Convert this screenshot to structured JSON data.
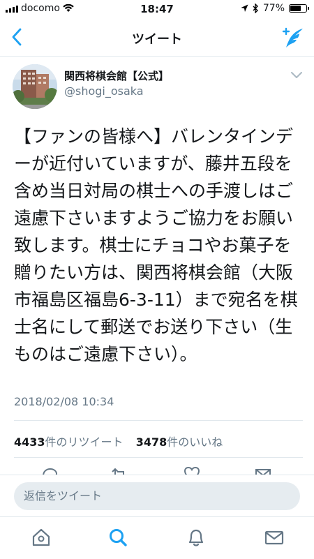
{
  "status_bar": {
    "carrier": "docomo",
    "time": "18:47",
    "battery_percent": "77%",
    "battery_level": 0.77
  },
  "nav": {
    "title": "ツイート",
    "back_icon": "chevron-left-icon",
    "compose_icon": "compose-tweet-icon"
  },
  "tweet": {
    "author_name": "関西将棋会館【公式】",
    "author_handle": "@shogi_osaka",
    "text": "【ファンの皆様へ】バレンタインデーが近付いていますが、藤井五段を含め当日対局の棋士への手渡しはご遠慮下さいますようご協力をお願い致します。棋士にチョコやお菓子を贈りたい方は、関西将棋会館（大阪市福島区福島6-3-11）まで宛名を棋士名にして郵送でお送り下さい（生ものはご遠慮下さい）。",
    "timestamp": "2018/02/08 10:34",
    "retweet_count": "4433",
    "retweet_label": "件のリツイート",
    "like_count": "3478",
    "like_label": "件のいいね"
  },
  "reply": {
    "placeholder": "返信をツイート"
  },
  "tab_bar": {
    "items": [
      "home-icon",
      "search-icon",
      "notifications-icon",
      "messages-icon"
    ]
  },
  "colors": {
    "accent": "#1da1f2",
    "text_primary": "#14171a",
    "text_secondary": "#657786",
    "divider": "#e1e8ed",
    "input_bg": "#e6ecf0"
  }
}
